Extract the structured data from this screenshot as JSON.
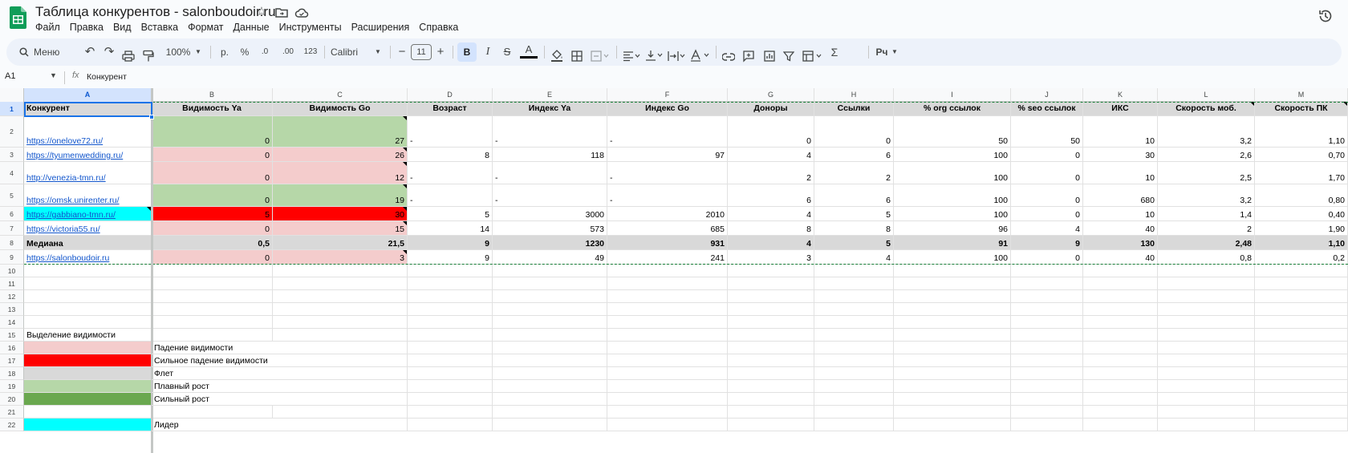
{
  "title": {
    "doc_name": "Таблица конкурентов - salonboudoir.ru",
    "icons": [
      "star-icon",
      "folder-move-icon",
      "cloud-icon",
      "history-icon"
    ]
  },
  "menu": [
    "Файл",
    "Правка",
    "Вид",
    "Вставка",
    "Формат",
    "Данные",
    "Инструменты",
    "Расширения",
    "Справка"
  ],
  "toolbar": {
    "search_label": "Меню",
    "zoom": "100%",
    "currency": "р.",
    "percent": "%",
    "dec_decrease": ".0",
    "dec_increase": ".00",
    "number_format": "123",
    "font": "Calibri",
    "font_size": "11",
    "bold": "B",
    "italic": "I",
    "text_color": "A",
    "input_tools": "Рч"
  },
  "formula_bar": {
    "cell_ref": "A1",
    "fx": "fx",
    "value": "Конкурент"
  },
  "columns": [
    "A",
    "B",
    "C",
    "D",
    "E",
    "F",
    "G",
    "H",
    "I",
    "J",
    "K",
    "L",
    "M"
  ],
  "header_row": [
    "Конкурент",
    "Видимость Ya",
    "Видимость Go",
    "Возраст",
    "Индекс Ya",
    "Индекс Go",
    "Доноры",
    "Ссылки",
    "% org ссылок",
    "% seo ссылок",
    "ИКС",
    "Скорость моб.",
    "Скорость ПК"
  ],
  "data_rows": [
    {
      "row": "2",
      "cells": [
        "https://onelove72.ru/",
        "0",
        "27",
        "-",
        "-",
        "-",
        "0",
        "0",
        "50",
        "50",
        "10",
        "3,2",
        "1,10"
      ]
    },
    {
      "row": "3",
      "cells": [
        "https://tyumenwedding.ru/",
        "0",
        "26",
        "8",
        "118",
        "97",
        "4",
        "6",
        "100",
        "0",
        "30",
        "2,6",
        "0,70"
      ]
    },
    {
      "row": "4",
      "cells": [
        "http://venezia-tmn.ru/",
        "0",
        "12",
        "-",
        "-",
        "-",
        "2",
        "2",
        "100",
        "0",
        "10",
        "2,5",
        "1,70"
      ]
    },
    {
      "row": "5",
      "cells": [
        "https://omsk.unirenter.ru/",
        "0",
        "19",
        "-",
        "-",
        "-",
        "6",
        "6",
        "100",
        "0",
        "680",
        "3,2",
        "0,80"
      ]
    },
    {
      "row": "6",
      "cells": [
        "https://gabbiano-tmn.ru/",
        "5",
        "30",
        "5",
        "3000",
        "2010",
        "4",
        "5",
        "100",
        "0",
        "10",
        "1,4",
        "0,40"
      ]
    },
    {
      "row": "7",
      "cells": [
        "https://victoria55.ru/",
        "0",
        "15",
        "14",
        "573",
        "685",
        "8",
        "8",
        "96",
        "4",
        "40",
        "2",
        "1,90"
      ]
    },
    {
      "row": "8",
      "cells": [
        "Медиана",
        "0,5",
        "21,5",
        "9",
        "1230",
        "931",
        "4",
        "5",
        "91",
        "9",
        "130",
        "2,48",
        "1,10"
      ]
    },
    {
      "row": "9",
      "cells": [
        "https://salonboudoir.ru",
        "0",
        "3",
        "9",
        "49",
        "241",
        "3",
        "4",
        "100",
        "0",
        "40",
        "0,8",
        "0,2"
      ]
    }
  ],
  "row_numbers": [
    "1",
    "2",
    "3",
    "4",
    "5",
    "6",
    "7",
    "8",
    "9",
    "10",
    "11",
    "12",
    "13",
    "14",
    "15",
    "16",
    "17",
    "18",
    "19",
    "20",
    "21",
    "22"
  ],
  "legend": {
    "title": "Выделение видимости",
    "items": [
      {
        "label": "Падение видимости",
        "color": "#f4cccc"
      },
      {
        "label": "Сильное падение видимости",
        "color": "#ff0000"
      },
      {
        "label": "Флет",
        "color": "#d9d9d9"
      },
      {
        "label": "Плавный рост",
        "color": "#b6d7a8"
      },
      {
        "label": "Сильный рост",
        "color": "#6aa84f"
      },
      {
        "label": "Лидер",
        "color": "#00ffff"
      }
    ]
  },
  "colors": {
    "pink": "#f4cccc",
    "red": "#ff0000",
    "light_green": "#b6d7a8",
    "dark_green": "#6aa84f",
    "gray": "#d9d9d9",
    "cyan": "#00ffff",
    "link": "#1155cc",
    "selection": "#1a73e8",
    "sheets_green": "#0f9d58"
  }
}
